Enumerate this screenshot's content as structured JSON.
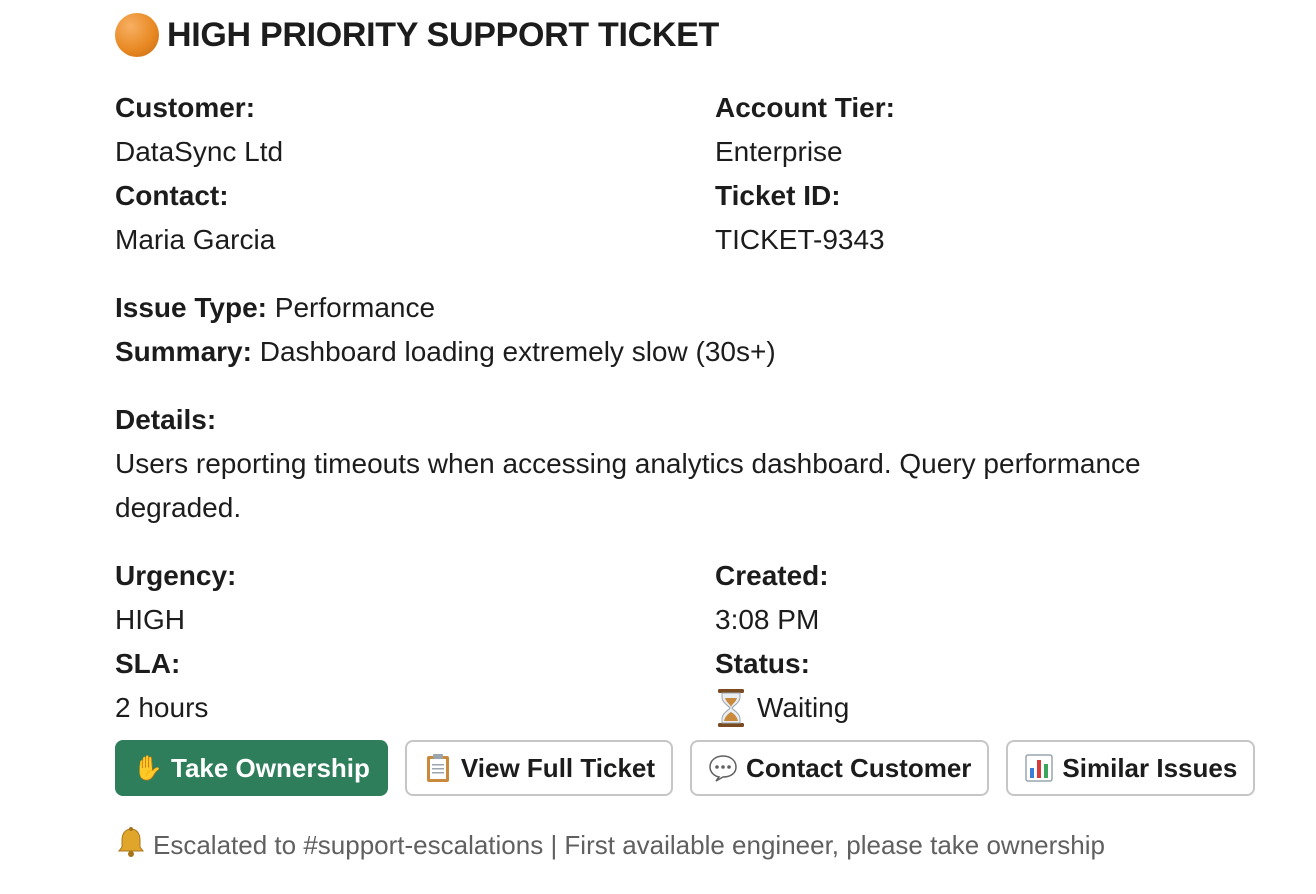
{
  "header": {
    "icon": "orange-circle-icon",
    "title": "HIGH PRIORITY SUPPORT TICKET"
  },
  "fields": {
    "customer_label": "Customer:",
    "customer_value": "DataSync Ltd",
    "account_tier_label": "Account Tier:",
    "account_tier_value": "Enterprise",
    "contact_label": "Contact:",
    "contact_value": "Maria Garcia",
    "ticket_id_label": "Ticket ID:",
    "ticket_id_value": "TICKET-9343"
  },
  "issue": {
    "type_label": "Issue Type:",
    "type_value": " Performance",
    "summary_label": "Summary:",
    "summary_value": " Dashboard loading extremely slow (30s+)"
  },
  "details": {
    "label": "Details:",
    "text": "Users reporting timeouts when accessing analytics dashboard. Query performance degraded."
  },
  "status_fields": {
    "urgency_label": "Urgency:",
    "urgency_value": "HIGH",
    "created_label": "Created:",
    "created_value": "3:08 PM",
    "sla_label": "SLA:",
    "sla_value": "2 hours",
    "status_label": "Status:",
    "status_icon": "hourglass-icon",
    "status_value": "Waiting"
  },
  "buttons": {
    "take_ownership": {
      "icon": "raised-hand-icon",
      "label": "Take Ownership"
    },
    "view_full_ticket": {
      "icon": "clipboard-icon",
      "label": "View Full Ticket"
    },
    "contact_customer": {
      "icon": "speech-bubble-icon",
      "label": "Contact Customer"
    },
    "similar_issues": {
      "icon": "bar-chart-icon",
      "label": "Similar Issues"
    }
  },
  "footer": {
    "icon": "bell-icon",
    "text": "Escalated to #support-escalations | First available engineer, please take ownership"
  },
  "colors": {
    "primary_button": "#2e7d5b",
    "accent_orange": "#e98a25",
    "muted_text": "#616061"
  }
}
